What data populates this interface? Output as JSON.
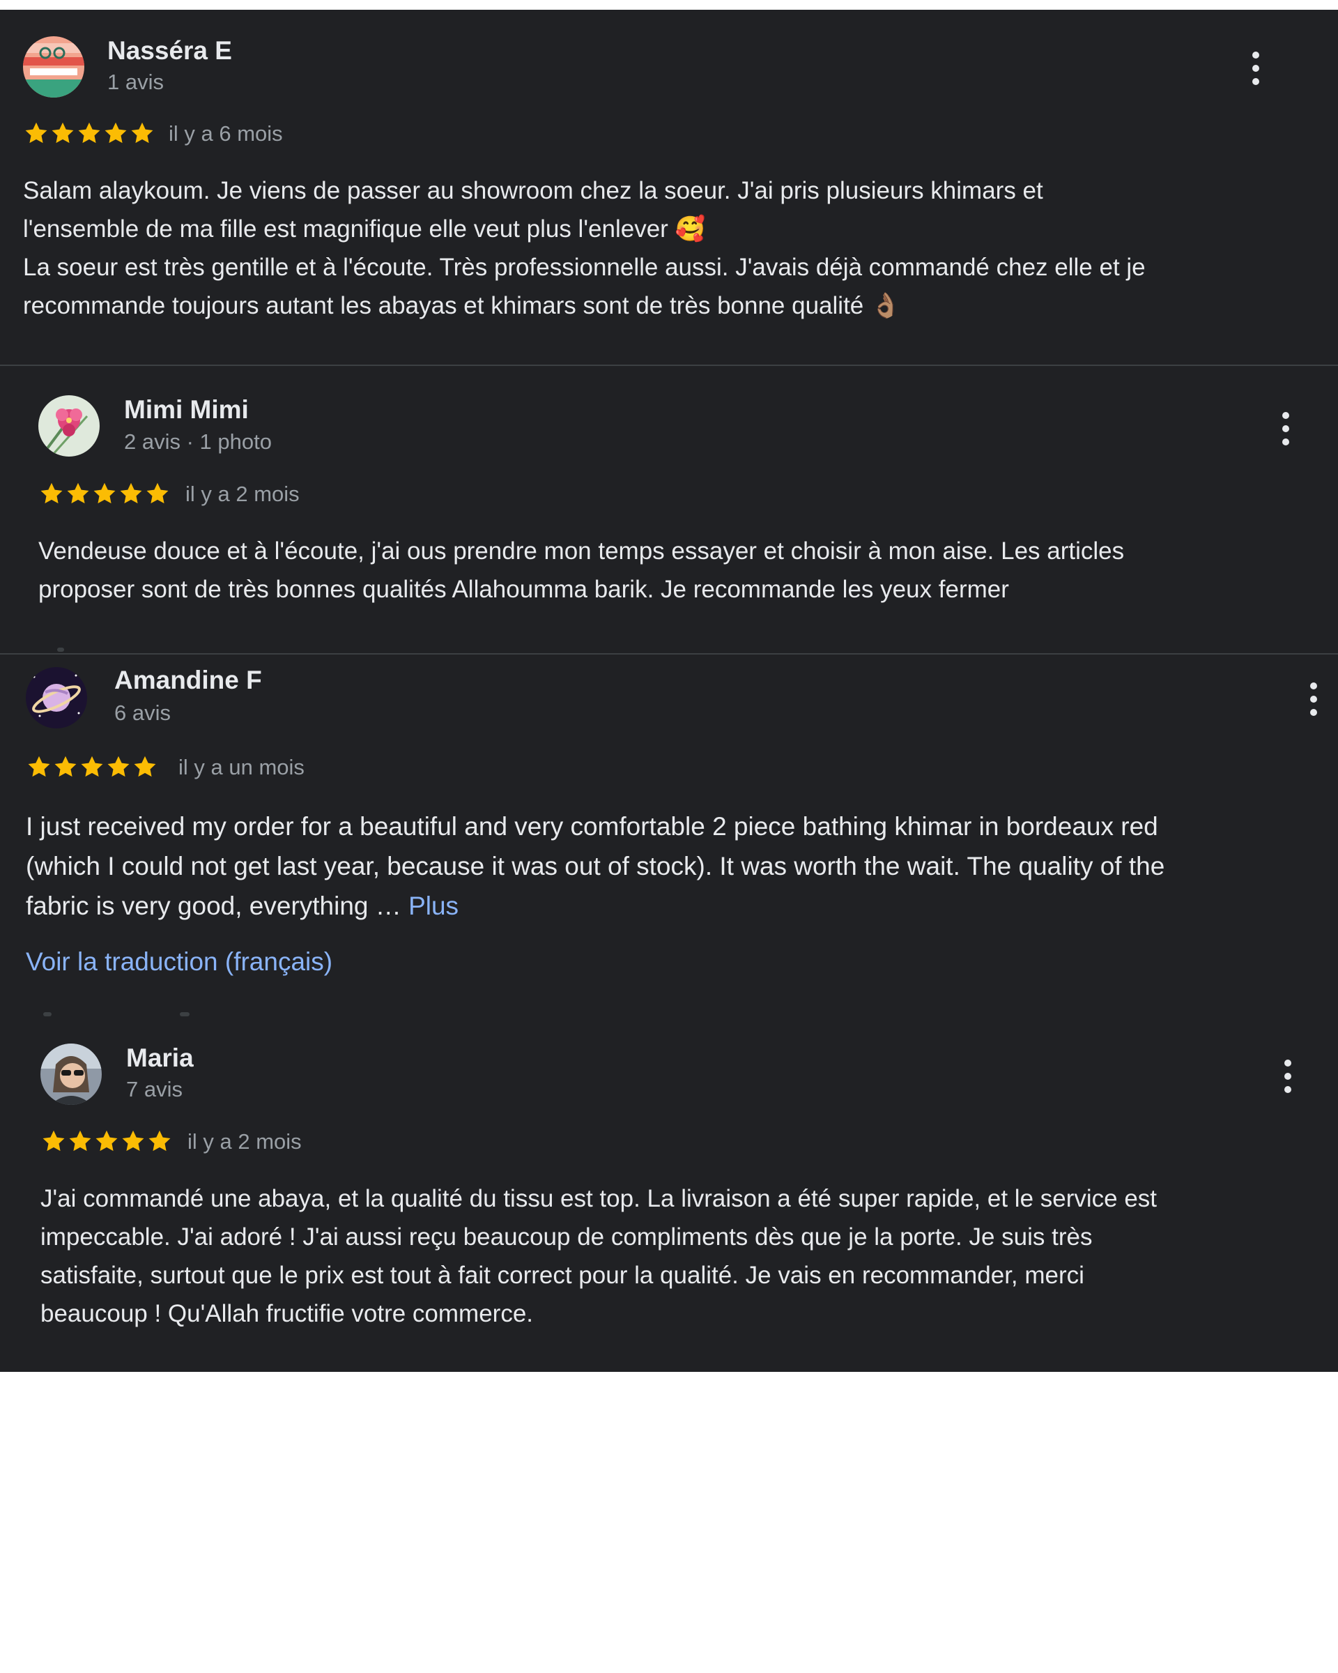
{
  "colors": {
    "panel_bg": "#202124",
    "text": "#e8eaed",
    "muted": "#9aa0a6",
    "star": "#fbbc04",
    "link": "#8ab4f8"
  },
  "reviews": [
    {
      "name": "Nasséra E",
      "meta": "1 avis",
      "rating": 5,
      "time": "il y a 6 mois",
      "text_lines": [
        "Salam alaykoum. Je viens de passer au showroom chez la soeur. J'ai pris plusieurs khimars et",
        "l'ensemble de ma fille est magnifique elle veut plus l'enlever 🥰",
        "La soeur est très gentille et à l'écoute. Très professionnelle aussi. J'avais déjà commandé chez elle et je",
        "recommande toujours autant les abayas et khimars sont de très bonne qualité 👌🏽"
      ],
      "menu_icon": "more-vert-icon"
    },
    {
      "name": "Mimi Mimi",
      "meta": "2 avis · 1 photo",
      "rating": 5,
      "time": "il y a 2 mois",
      "text_lines": [
        "Vendeuse douce et à l'écoute, j'ai ous prendre mon temps essayer et choisir à mon aise. Les articles",
        "proposer sont de très bonnes qualités Allahoumma barik. Je recommande les yeux fermer"
      ],
      "menu_icon": "more-vert-icon"
    },
    {
      "name": "Amandine F",
      "meta": "6 avis",
      "rating": 5,
      "time": "il y a un mois",
      "text_lines": [
        "I just received my order for a beautiful and very comfortable 2 piece bathing khimar in bordeaux red",
        "(which I could not get last year, because it was out of stock). It was worth the wait. The quality of the",
        "fabric is very good, everything … "
      ],
      "more_link": "Plus",
      "translate_link": "Voir la traduction (français)",
      "menu_icon": "more-vert-icon"
    },
    {
      "name": "Maria",
      "meta": "7 avis",
      "rating": 5,
      "time": "il y a 2 mois",
      "text_lines": [
        "J'ai commandé une abaya, et la qualité du tissu est top. La livraison a été super rapide, et le service est",
        "impeccable. J'ai adoré ! J'ai aussi reçu beaucoup de compliments dès que je la porte. Je suis très",
        "satisfaite, surtout que le prix est tout à fait correct pour la qualité. Je vais en recommander, merci",
        "beaucoup ! Qu'Allah fructifie votre commerce."
      ],
      "menu_icon": "more-vert-icon"
    }
  ]
}
